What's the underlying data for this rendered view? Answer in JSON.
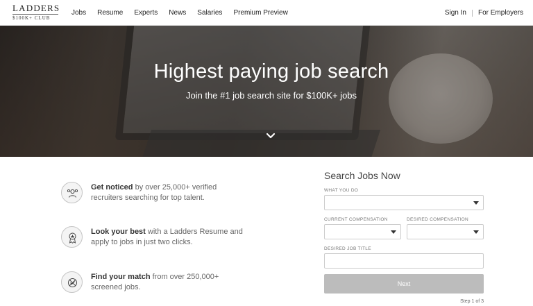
{
  "nav": {
    "logo_word": "LADDERS",
    "logo_sub": "$100K+ CLUB",
    "links": [
      "Jobs",
      "Resume",
      "Experts",
      "News",
      "Salaries",
      "Premium Preview"
    ],
    "sign_in": "Sign In",
    "employers": "For Employers"
  },
  "hero": {
    "title": "Highest paying job search",
    "subtitle": "Join the #1 job search site for $100K+ jobs",
    "chevron_icon": "chevron-down-icon"
  },
  "features": [
    {
      "icon": "recruiters-icon",
      "bold": "Get noticed",
      "text": " by over 25,000+ verified recruiters searching for top talent."
    },
    {
      "icon": "award-ribbon-icon",
      "bold": "Look your best",
      "text": " with a Ladders Resume and apply to jobs in just two clicks."
    },
    {
      "icon": "match-icon",
      "bold": "Find your match",
      "text": " from over 250,000+ screened jobs."
    }
  ],
  "form": {
    "title": "Search Jobs Now",
    "what_you_do_label": "WHAT YOU DO",
    "what_you_do_value": "",
    "current_comp_label": "CURRENT COMPENSATION",
    "current_comp_value": "",
    "desired_comp_label": "DESIRED COMPENSATION",
    "desired_comp_value": "",
    "desired_title_label": "DESIRED JOB TITLE",
    "desired_title_value": "",
    "next_label": "Next",
    "step_text": "Step 1 of 3"
  },
  "colors": {
    "nav_bg": "#ffffff",
    "button_disabled": "#bcbcbc",
    "hero_text": "#ffffff"
  }
}
